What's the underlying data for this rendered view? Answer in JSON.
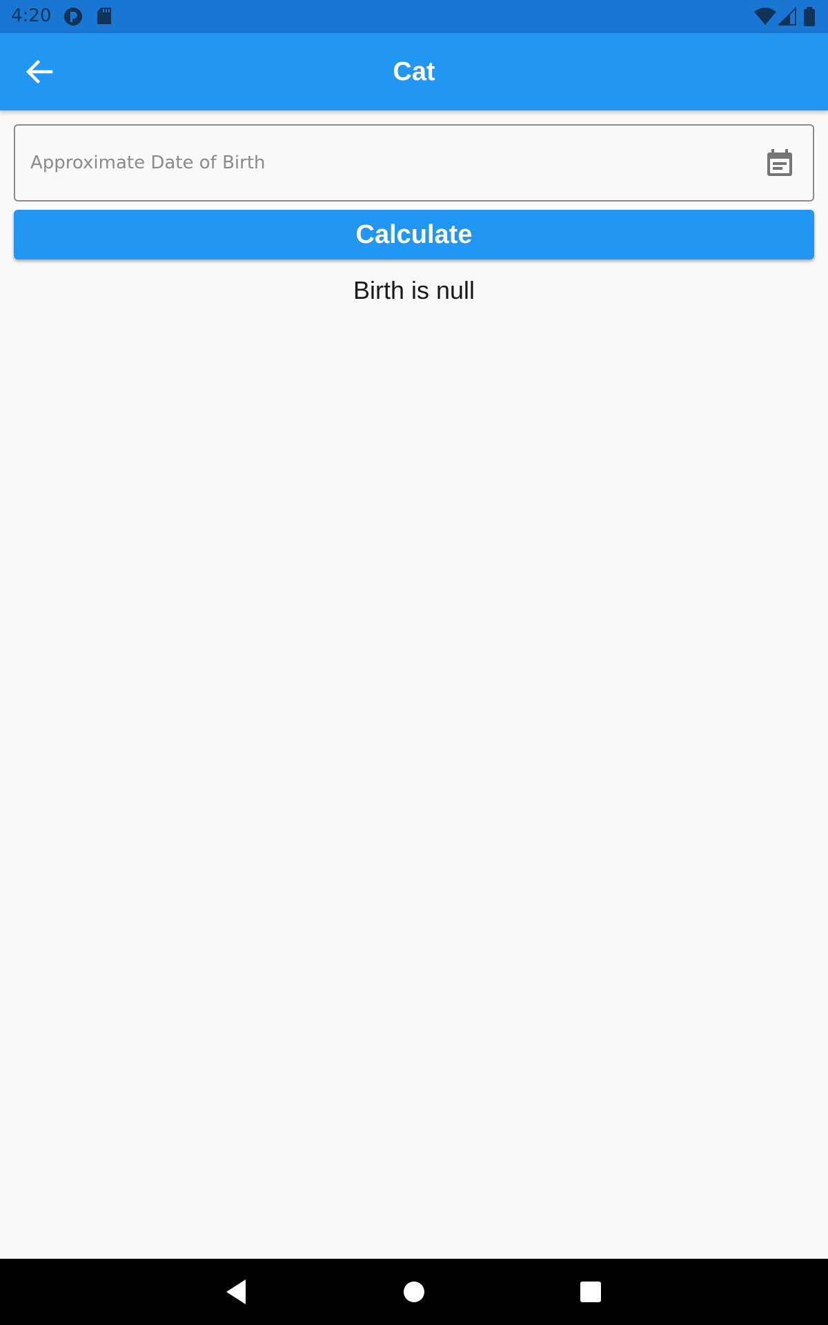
{
  "status_bar": {
    "time": "4:20",
    "icons": [
      "notification-app-icon",
      "sd-card-icon",
      "wifi-icon",
      "cell-signal-icon",
      "battery-icon"
    ]
  },
  "app_bar": {
    "title": "Cat",
    "back_icon": "arrow-back-icon",
    "color": "#2196f3"
  },
  "date_field": {
    "placeholder": "Approximate Date of Birth",
    "value": "",
    "icon": "calendar-icon"
  },
  "calculate_button": {
    "label": "Calculate",
    "color": "#2196f3"
  },
  "result": {
    "text": "Birth is null"
  },
  "nav_bar": {
    "buttons": [
      "back-triangle-icon",
      "home-circle-icon",
      "recents-square-icon"
    ]
  }
}
